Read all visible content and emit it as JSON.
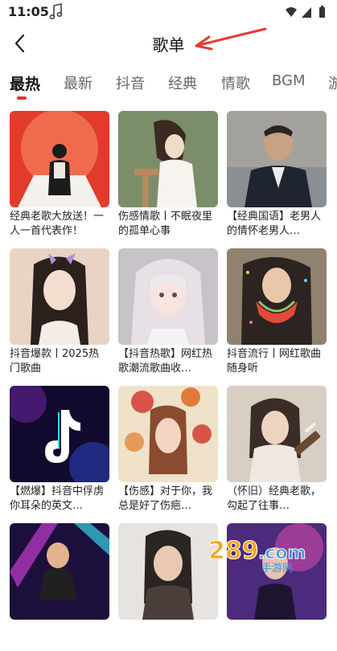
{
  "status": {
    "time": "11:05"
  },
  "header": {
    "title": "歌单"
  },
  "tabs": [
    "最热",
    "最新",
    "抖音",
    "经典",
    "情歌",
    "BGM",
    "游"
  ],
  "playlists": [
    {
      "title": "经典老歌大放送！一人一首代表作！"
    },
    {
      "title": "伤感情歌丨不眠夜里的孤单心事"
    },
    {
      "title": "【经典国语】老男人的情怀老男人…"
    },
    {
      "title": "抖音爆款丨2025热门歌曲"
    },
    {
      "title": "【抖音热歌】网红热歌潮流歌曲收…"
    },
    {
      "title": "抖音流行丨网红歌曲随身听"
    },
    {
      "title": "【燃爆】抖音中俘虏你耳朵的英文…"
    },
    {
      "title": "【伤感】对于你，我总是好了伤疤…"
    },
    {
      "title": "（怀旧）经典老歌，勾起了往事…"
    },
    {
      "title": ""
    },
    {
      "title": ""
    },
    {
      "title": ""
    }
  ],
  "watermark": {
    "text": "289.com",
    "subtext": "手游网"
  },
  "colors": {
    "accent": "#e5322d",
    "annotation": "#e53a35"
  }
}
